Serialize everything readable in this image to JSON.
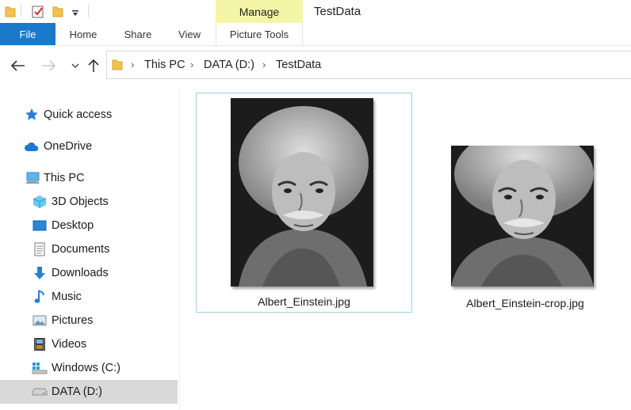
{
  "window": {
    "title": "TestData"
  },
  "quick_access_toolbar": {
    "icons": [
      "folder-icon",
      "properties-check-icon",
      "new-folder-icon",
      "customize-dropdown-icon"
    ]
  },
  "ribbon": {
    "contextual_group_label": "Manage",
    "tabs": [
      {
        "label": "File",
        "active": true
      },
      {
        "label": "Home"
      },
      {
        "label": "Share"
      },
      {
        "label": "View"
      },
      {
        "label": "Picture Tools"
      }
    ]
  },
  "address_bar": {
    "breadcrumbs": [
      "This PC",
      "DATA (D:)",
      "TestData"
    ]
  },
  "sidebar": {
    "items": [
      {
        "label": "Quick access",
        "icon": "star-icon"
      },
      {
        "label": "OneDrive",
        "icon": "cloud-icon"
      },
      {
        "label": "This PC",
        "icon": "computer-icon"
      },
      {
        "label": "3D Objects",
        "icon": "cube-icon"
      },
      {
        "label": "Desktop",
        "icon": "desktop-icon"
      },
      {
        "label": "Documents",
        "icon": "document-icon"
      },
      {
        "label": "Downloads",
        "icon": "download-arrow-icon"
      },
      {
        "label": "Music",
        "icon": "music-note-icon"
      },
      {
        "label": "Pictures",
        "icon": "pictures-icon"
      },
      {
        "label": "Videos",
        "icon": "film-icon"
      },
      {
        "label": "Windows (C:)",
        "icon": "windows-drive-icon"
      },
      {
        "label": "DATA (D:)",
        "icon": "drive-icon",
        "selected": true
      }
    ]
  },
  "files": [
    {
      "name": "Albert_Einstein.jpg",
      "selected": true
    },
    {
      "name": "Albert_Einstein-crop.jpg",
      "selected": false
    }
  ],
  "colors": {
    "file_tab": "#1979ca",
    "manage_highlight": "#f5f5a8",
    "selection_border": "#99d1db",
    "sidebar_selected": "#d9d9d9"
  }
}
